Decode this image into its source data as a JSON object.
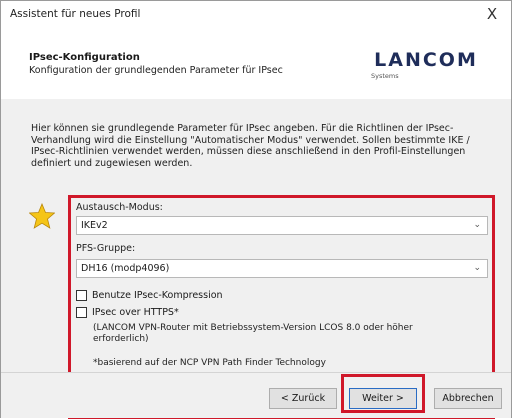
{
  "window": {
    "title": "Assistent für neues Profil",
    "close_symbol": "X"
  },
  "header": {
    "title": "IPsec-Konfiguration",
    "subtitle": "Konfiguration der grundlegenden Parameter für IPsec",
    "logo_text": "LANCOM",
    "logo_sub": "Systems"
  },
  "content": {
    "intro": "Hier können sie grundlegende Parameter für IPsec angeben. Für die Richtlinen der IPsec-Verhandlung wird die Einstellung \"Automatischer Modus\" verwendet. Sollen bestimmte IKE / IPsec-Richtlinien verwendet werden, müssen diese anschließend in den Profil-Einstellungen definiert und zugewiesen werden.",
    "exchange_mode_label": "Austausch-Modus:",
    "exchange_mode_value": "IKEv2",
    "pfs_group_label": "PFS-Gruppe:",
    "pfs_group_value": "DH16 (modp4096)",
    "compression_label": "Benutze IPsec-Kompression",
    "compression_checked": false,
    "https_label": "IPsec over HTTPS*",
    "https_checked": false,
    "note_line1": "(LANCOM VPN-Router mit Betriebssystem-Version LCOS 8.0 oder höher",
    "note_line2": "erforderlich)",
    "footnote": "*basierend auf der NCP VPN Path Finder Technology"
  },
  "footer": {
    "back_label": "< Zurück",
    "next_label": "Weiter >",
    "cancel_label": "Abbrechen"
  },
  "icons": {
    "star_color": "#f5c518",
    "chevron": "chevron-down-icon"
  },
  "colors": {
    "highlight": "#d0182a",
    "logo": "#1f2d5a"
  }
}
